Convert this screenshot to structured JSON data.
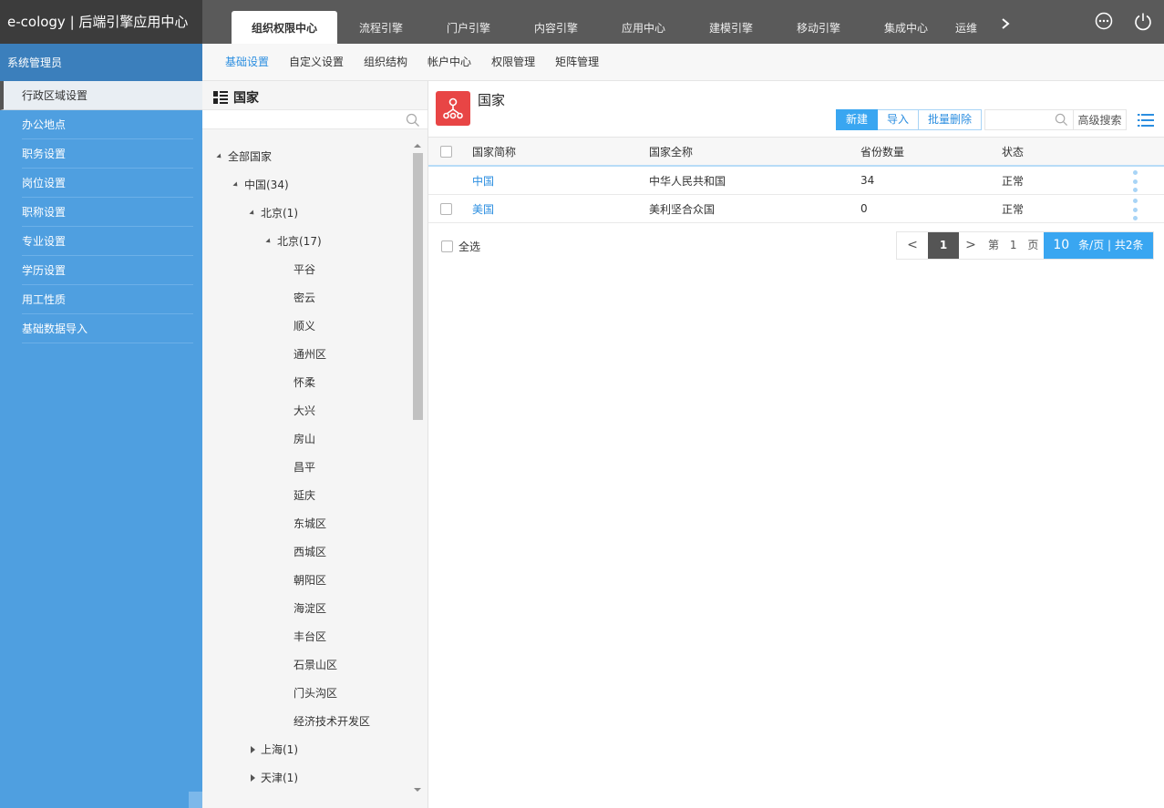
{
  "app": {
    "brand": "e-cology | 后端引擎应用中心"
  },
  "top_tabs": [
    {
      "label": "组织权限中心",
      "active": true
    },
    {
      "label": "流程引擎"
    },
    {
      "label": "门户引擎"
    },
    {
      "label": "内容引擎"
    },
    {
      "label": "应用中心"
    },
    {
      "label": "建模引擎"
    },
    {
      "label": "移动引擎"
    },
    {
      "label": "集成中心"
    },
    {
      "label": "运维"
    }
  ],
  "sidebar": {
    "header": "系统管理员",
    "items": [
      {
        "label": "行政区域设置",
        "active": true
      },
      {
        "label": "办公地点"
      },
      {
        "label": "职务设置"
      },
      {
        "label": "岗位设置"
      },
      {
        "label": "职称设置"
      },
      {
        "label": "专业设置"
      },
      {
        "label": "学历设置"
      },
      {
        "label": "用工性质"
      },
      {
        "label": "基础数据导入"
      }
    ]
  },
  "subnav": [
    {
      "label": "基础设置",
      "active": true
    },
    {
      "label": "自定义设置"
    },
    {
      "label": "组织结构"
    },
    {
      "label": "帐户中心"
    },
    {
      "label": "权限管理"
    },
    {
      "label": "矩阵管理"
    }
  ],
  "tree": {
    "title": "国家",
    "nodes": [
      {
        "label": "全部国家",
        "expanded": true
      },
      {
        "label": "中国(34)",
        "expanded": true
      },
      {
        "label": "北京(1)",
        "expanded": true
      },
      {
        "label": "北京(17)",
        "expanded": true
      },
      {
        "label": "平谷"
      },
      {
        "label": "密云"
      },
      {
        "label": "顺义"
      },
      {
        "label": "通州区"
      },
      {
        "label": "怀柔"
      },
      {
        "label": "大兴"
      },
      {
        "label": "房山"
      },
      {
        "label": "昌平"
      },
      {
        "label": "延庆"
      },
      {
        "label": "东城区"
      },
      {
        "label": "西城区"
      },
      {
        "label": "朝阳区"
      },
      {
        "label": "海淀区"
      },
      {
        "label": "丰台区"
      },
      {
        "label": "石景山区"
      },
      {
        "label": "门头沟区"
      },
      {
        "label": "经济技术开发区"
      },
      {
        "label": "上海(1)",
        "expanded": false
      },
      {
        "label": "天津(1)",
        "expanded": false
      }
    ]
  },
  "main": {
    "title": "国家",
    "buttons": {
      "new": "新建",
      "import": "导入",
      "batch_delete": "批量删除"
    },
    "search": {
      "placeholder": "",
      "advanced": "高级搜索"
    },
    "table": {
      "headers": [
        "国家简称",
        "国家全称",
        "省份数量",
        "状态"
      ],
      "rows": [
        {
          "short": "中国",
          "full": "中华人民共和国",
          "count": "34",
          "status": "正常"
        },
        {
          "short": "美国",
          "full": "美利坚合众国",
          "count": "0",
          "status": "正常"
        }
      ]
    },
    "select_all": "全选",
    "pager": {
      "prev": "<",
      "current": "1",
      "next": ">",
      "page_prefix": "第",
      "page_num": "1",
      "page_suffix": "页",
      "page_size": "10",
      "page_size_suffix": "条/页 | 共2条"
    }
  },
  "colors": {
    "accent": "#39a6f1",
    "sidebar": "#4f9fe0",
    "sidebar_header": "#3b7fbc",
    "topbar": "#5a5a5a",
    "icon_red": "#e84545"
  }
}
